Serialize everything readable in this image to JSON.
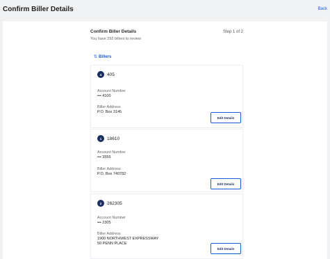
{
  "topbar": {
    "title": "Confirm Biller Details",
    "back_label": "Back"
  },
  "header": {
    "title": "Confirm Biller Details",
    "step": "Step 1 of 2",
    "subtitle": "You have 292 billers to review"
  },
  "sort": {
    "icon": "sort-icon",
    "label": "Billers"
  },
  "labels": {
    "account_number": "Account Number",
    "biller_address": "Biller Address"
  },
  "billers": [
    {
      "badge": "4",
      "id": "405",
      "account": "••• 4100",
      "address_lines": [
        "P.O. Box 3145"
      ],
      "edit_label": "Edit Details"
    },
    {
      "badge": "1",
      "id": "18610",
      "account": "••• 3555",
      "address_lines": [
        "P.O. Box 740782"
      ],
      "edit_label": "Edit Details"
    },
    {
      "badge": "2",
      "id": "262305",
      "account": "••• 2305",
      "address_lines": [
        "1900 NORTHWEST EXPRESSWAY",
        "50 PENN PLACE"
      ],
      "edit_label": "Edit Details"
    }
  ],
  "colors": {
    "accent": "#1a5bd6",
    "badge_bg": "#1c2f63",
    "page_bg": "#f1f2f4",
    "panel_bg": "#ffffff"
  }
}
